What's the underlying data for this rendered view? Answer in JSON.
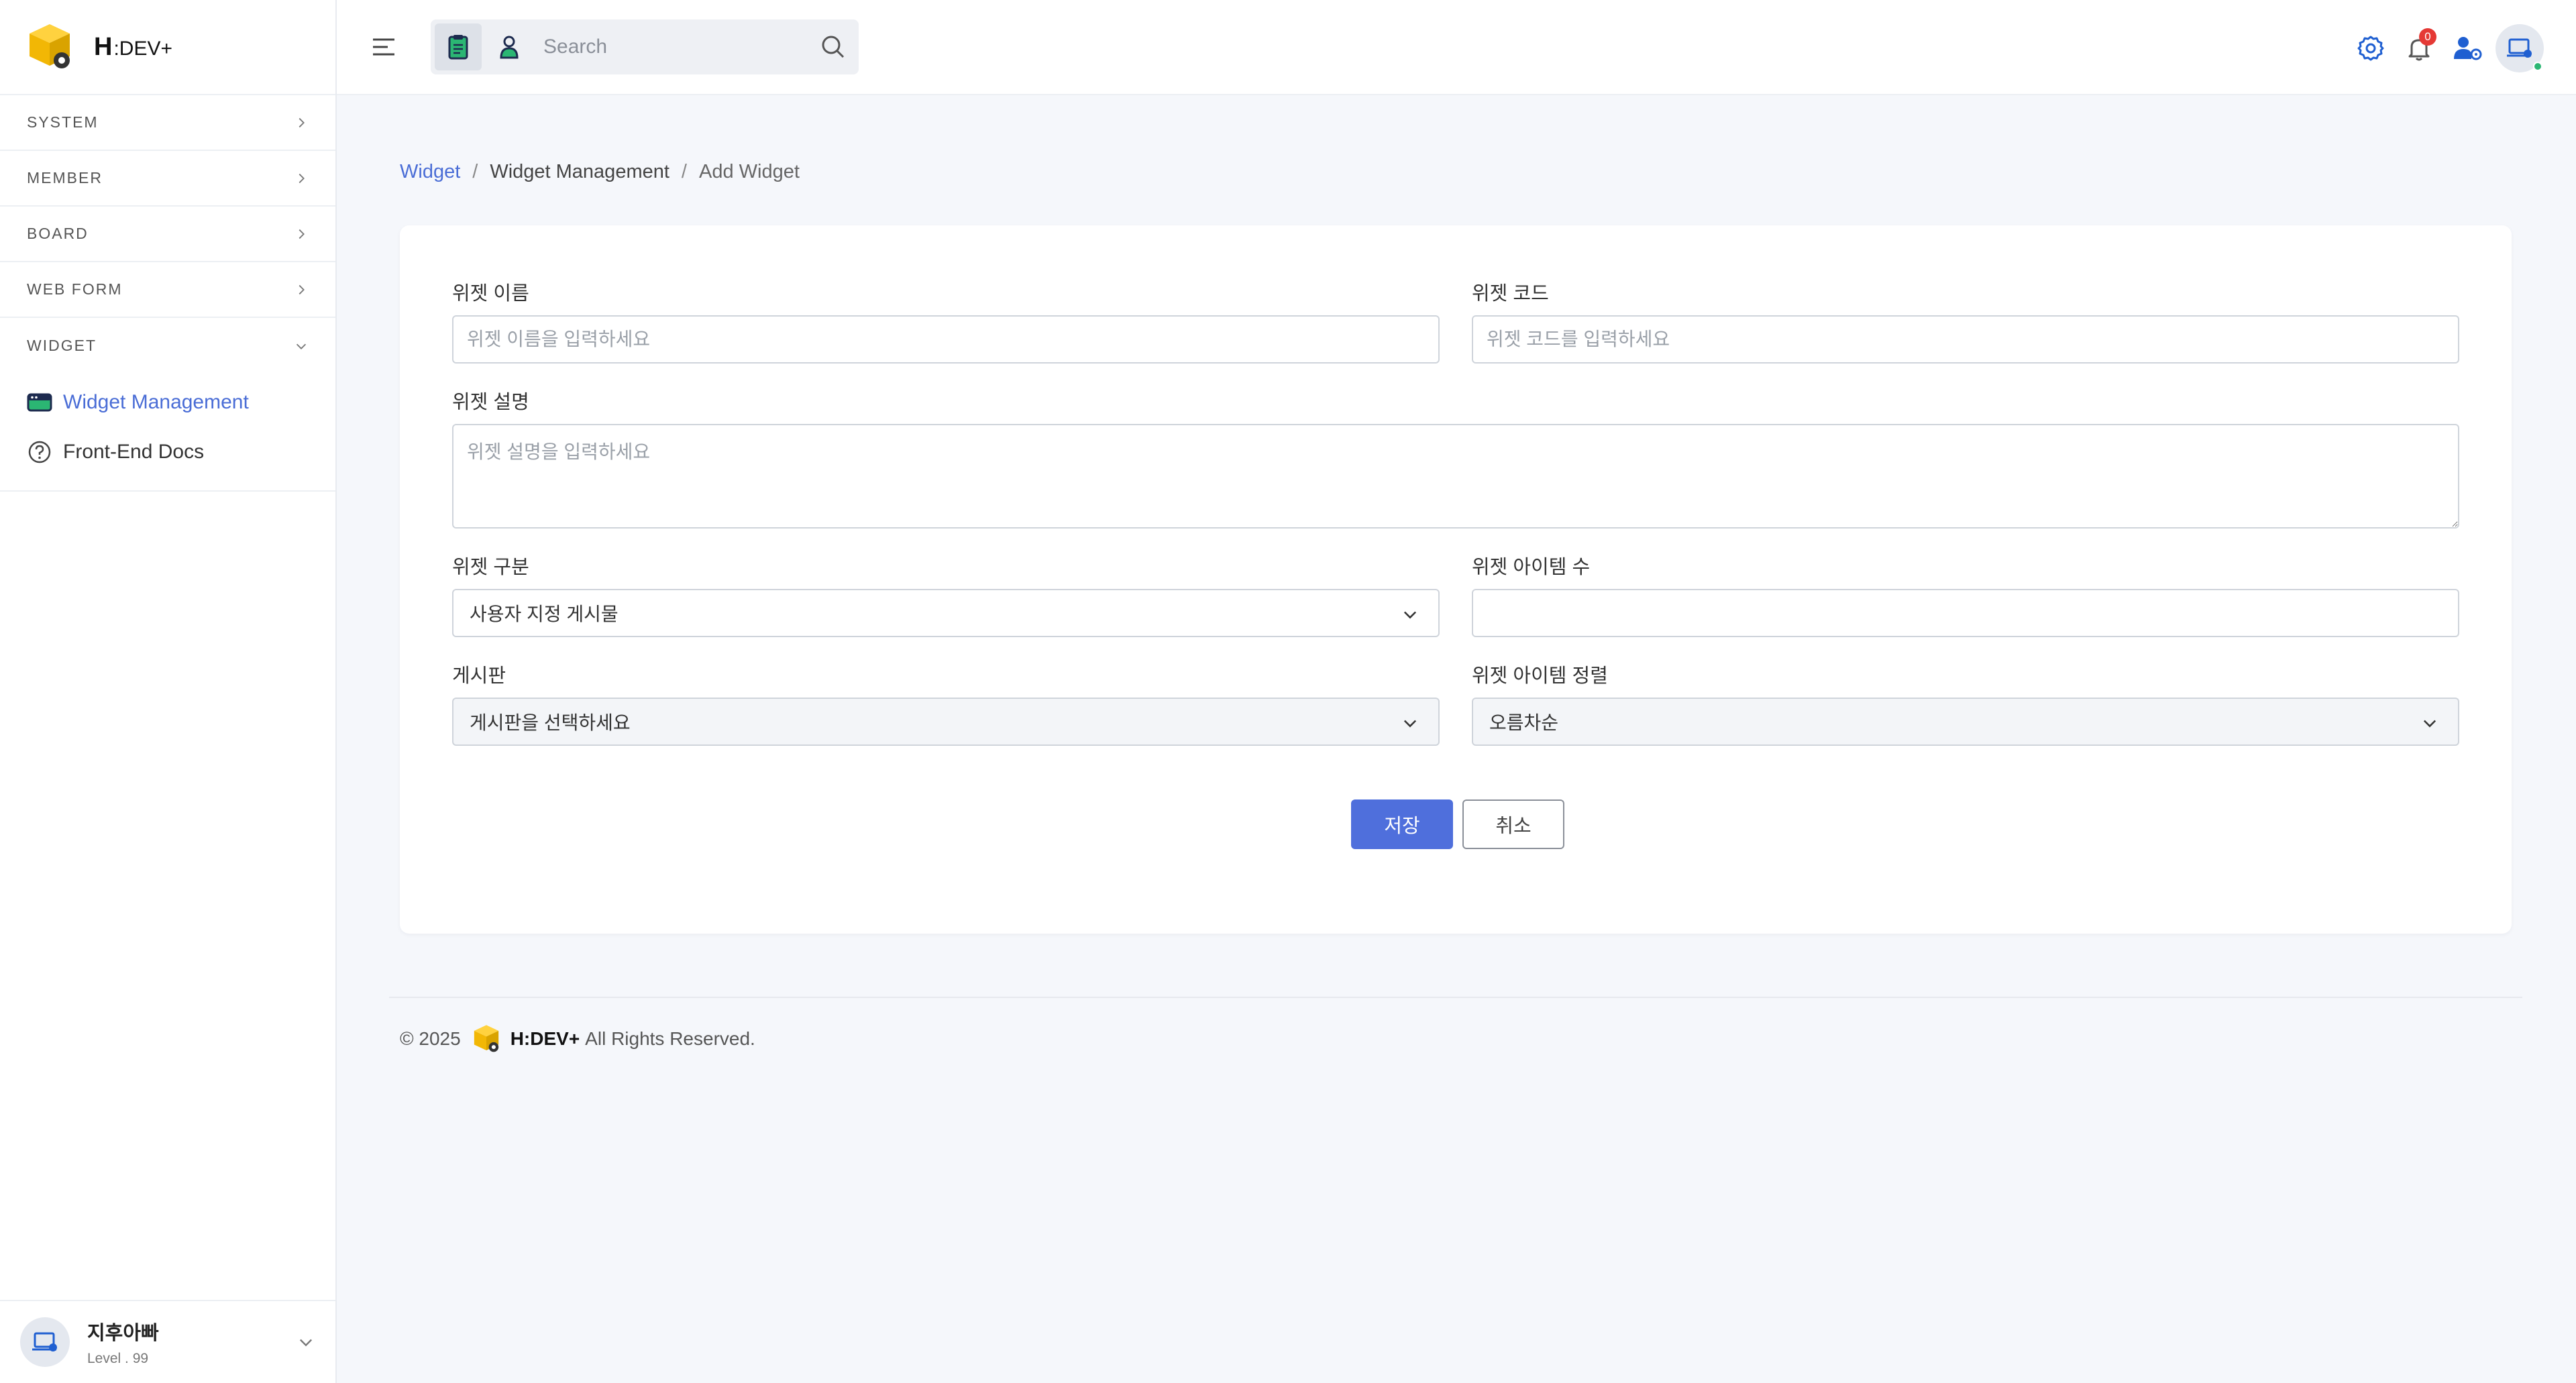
{
  "brand": {
    "name_bold": "H",
    "name_rest": ":DEV+"
  },
  "sidebar": {
    "sections": [
      {
        "label": "SYSTEM"
      },
      {
        "label": "MEMBER"
      },
      {
        "label": "BOARD"
      },
      {
        "label": "WEB FORM"
      },
      {
        "label": "WIDGET"
      }
    ],
    "widget_items": [
      {
        "label": "Widget Management",
        "active": true
      },
      {
        "label": "Front-End Docs",
        "active": false
      }
    ],
    "user": {
      "name": "지후아빠",
      "level": "Level . 99"
    }
  },
  "topbar": {
    "search": {
      "placeholder": "Search"
    },
    "notification_count": "0"
  },
  "breadcrumb": {
    "root": "Widget",
    "middle": "Widget Management",
    "current": "Add Widget",
    "separator": "/"
  },
  "form": {
    "name": {
      "label": "위젯 이름",
      "placeholder": "위젯 이름을 입력하세요",
      "value": ""
    },
    "code": {
      "label": "위젯 코드",
      "placeholder": "위젯 코드를 입력하세요",
      "value": ""
    },
    "description": {
      "label": "위젯 설명",
      "placeholder": "위젯 설명을 입력하세요",
      "value": ""
    },
    "type": {
      "label": "위젯 구분",
      "selected": "사용자 지정 게시물"
    },
    "item_count": {
      "label": "위젯 아이템 수",
      "value": ""
    },
    "board": {
      "label": "게시판",
      "selected": "게시판을 선택하세요"
    },
    "sort": {
      "label": "위젯 아이템 정렬",
      "selected": "오름차순"
    },
    "save_label": "저장",
    "cancel_label": "취소"
  },
  "footer": {
    "copyright": "© 2025",
    "brand": "H:DEV+",
    "rights": "All Rights Reserved."
  },
  "colors": {
    "accent": "#4f6fdc",
    "link": "#4a6dd6",
    "page_bg": "#f5f7fb",
    "badge": "#e53935",
    "online": "#2bb673"
  }
}
